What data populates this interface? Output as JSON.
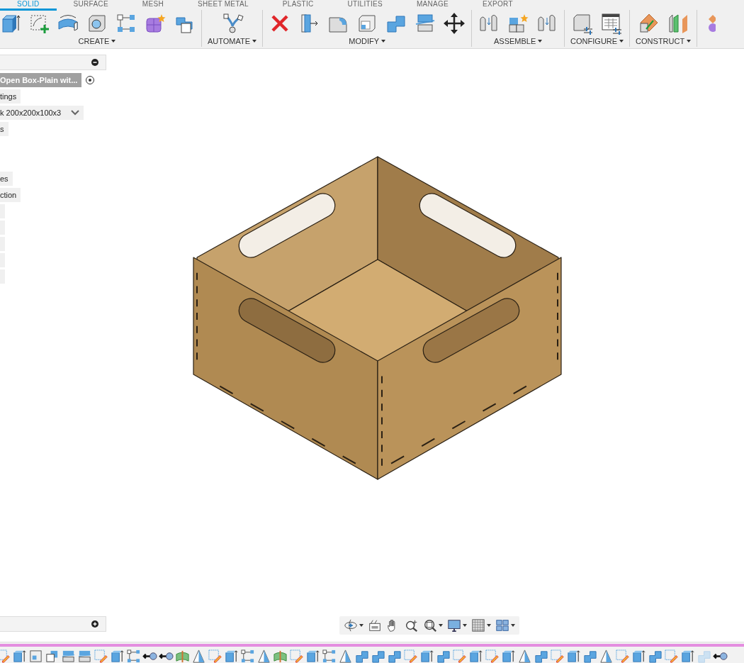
{
  "workspace_tabs": [
    {
      "label": "SOLID",
      "selected": true
    },
    {
      "label": "SURFACE",
      "selected": false
    },
    {
      "label": "MESH",
      "selected": false
    },
    {
      "label": "SHEET METAL",
      "selected": false
    },
    {
      "label": "PLASTIC",
      "selected": false
    },
    {
      "label": "UTILITIES",
      "selected": false
    },
    {
      "label": "MANAGE",
      "selected": false
    },
    {
      "label": "EXPORT",
      "selected": false
    }
  ],
  "toolbar_groups": [
    {
      "label": "CREATE",
      "tools": [
        {
          "kind": "extrude"
        },
        {
          "kind": "sketch"
        },
        {
          "kind": "revolve"
        },
        {
          "kind": "hole"
        },
        {
          "kind": "pattern"
        },
        {
          "kind": "form"
        },
        {
          "kind": "derive"
        }
      ]
    },
    {
      "label": "AUTOMATE",
      "tools": [
        {
          "kind": "automate"
        }
      ]
    },
    {
      "label": "MODIFY",
      "tools": [
        {
          "kind": "delete"
        },
        {
          "kind": "presspull"
        },
        {
          "kind": "fillet"
        },
        {
          "kind": "shell"
        },
        {
          "kind": "combine"
        },
        {
          "kind": "split"
        },
        {
          "kind": "move"
        }
      ]
    },
    {
      "label": "ASSEMBLE",
      "tools": [
        {
          "kind": "joint"
        },
        {
          "kind": "component"
        },
        {
          "kind": "joint"
        }
      ]
    },
    {
      "label": "CONFIGURE",
      "tools": [
        {
          "kind": "cubeconfig"
        },
        {
          "kind": "tableconfig"
        }
      ]
    },
    {
      "label": "CONSTRUCT",
      "tools": [
        {
          "kind": "plane"
        },
        {
          "kind": "midplane"
        }
      ]
    }
  ],
  "browser": {
    "items": [
      {
        "kind": "radio",
        "label": "Open Box-Plain wit...",
        "selected": true
      },
      {
        "kind": "plain",
        "label": "tings"
      },
      {
        "kind": "dropdown",
        "label": "k 200x200x100x3"
      },
      {
        "kind": "plain",
        "label": "s"
      },
      {
        "kind": "spacer"
      },
      {
        "kind": "plain",
        "label": "es"
      },
      {
        "kind": "plain",
        "label": "ction"
      },
      {
        "kind": "blank"
      },
      {
        "kind": "blank"
      },
      {
        "kind": "blank"
      },
      {
        "kind": "blank"
      },
      {
        "kind": "blank"
      }
    ]
  },
  "navbar": [
    {
      "kind": "orbit",
      "dropdown": true
    },
    {
      "kind": "lookat",
      "dropdown": false
    },
    {
      "kind": "pan",
      "dropdown": false
    },
    {
      "kind": "zoom",
      "dropdown": false
    },
    {
      "kind": "fitzoom",
      "dropdown": true
    },
    {
      "kind": "display",
      "dropdown": true
    },
    {
      "kind": "grid",
      "dropdown": true
    },
    {
      "kind": "viewports",
      "dropdown": true
    }
  ],
  "timeline": [
    {
      "kind": "sketch"
    },
    {
      "kind": "extrude"
    },
    {
      "kind": "shell"
    },
    {
      "kind": "outline"
    },
    {
      "kind": "split"
    },
    {
      "kind": "split"
    },
    {
      "kind": "sketch"
    },
    {
      "kind": "extrude"
    },
    {
      "kind": "pattern"
    },
    {
      "kind": "pin"
    },
    {
      "kind": "pin"
    },
    {
      "kind": "surface"
    },
    {
      "kind": "triangle"
    },
    {
      "kind": "sketch"
    },
    {
      "kind": "extrude"
    },
    {
      "kind": "pattern"
    },
    {
      "kind": "triangle"
    },
    {
      "kind": "surface"
    },
    {
      "kind": "sketch"
    },
    {
      "kind": "extrude"
    },
    {
      "kind": "pattern"
    },
    {
      "kind": "triangle"
    },
    {
      "kind": "combine"
    },
    {
      "kind": "combine"
    },
    {
      "kind": "combine"
    },
    {
      "kind": "sketch"
    },
    {
      "kind": "extrude"
    },
    {
      "kind": "combine"
    },
    {
      "kind": "sketch"
    },
    {
      "kind": "extrude"
    },
    {
      "kind": "sketch"
    },
    {
      "kind": "extrude"
    },
    {
      "kind": "triangle"
    },
    {
      "kind": "combine"
    },
    {
      "kind": "sketch"
    },
    {
      "kind": "extrude"
    },
    {
      "kind": "combine"
    },
    {
      "kind": "triangle"
    },
    {
      "kind": "sketch"
    },
    {
      "kind": "extrude"
    },
    {
      "kind": "combine"
    },
    {
      "kind": "sketch"
    },
    {
      "kind": "extrude"
    },
    {
      "kind": "faded"
    },
    {
      "kind": "pin"
    }
  ]
}
